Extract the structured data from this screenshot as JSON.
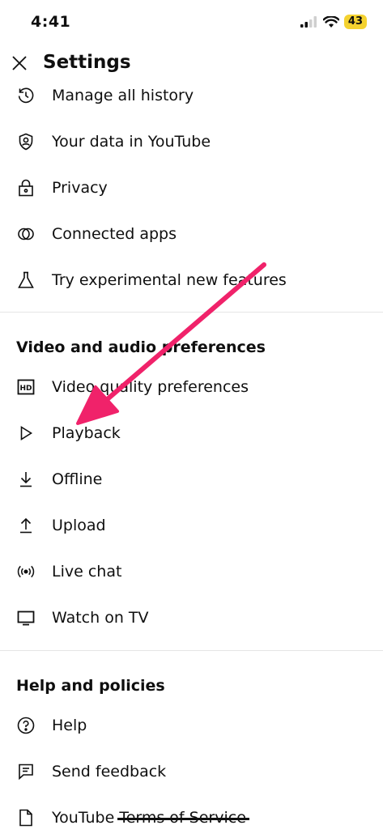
{
  "status_bar": {
    "time": "4:41",
    "battery": "43"
  },
  "header": {
    "title": "Settings"
  },
  "general_items": [
    {
      "label": "Manage all history",
      "icon": "history-icon"
    },
    {
      "label": "Your data in YouTube",
      "icon": "shield-person-icon"
    },
    {
      "label": "Privacy",
      "icon": "lock-icon"
    },
    {
      "label": "Connected apps",
      "icon": "connected-apps-icon"
    },
    {
      "label": "Try experimental new features",
      "icon": "flask-icon"
    }
  ],
  "video_audio": {
    "title": "Video and audio preferences",
    "items": [
      {
        "label": "Video quality preferences",
        "icon": "hd-icon"
      },
      {
        "label": "Playback",
        "icon": "play-icon"
      },
      {
        "label": "Offline",
        "icon": "download-icon"
      },
      {
        "label": "Upload",
        "icon": "upload-icon"
      },
      {
        "label": "Live chat",
        "icon": "live-icon"
      },
      {
        "label": "Watch on TV",
        "icon": "tv-icon"
      }
    ]
  },
  "help": {
    "title": "Help and policies",
    "items": [
      {
        "label": "Help",
        "icon": "help-icon"
      },
      {
        "label": "Send feedback",
        "icon": "feedback-icon"
      },
      {
        "label_main": "YouTube",
        "label_struck": "Terms of Service",
        "icon": "document-icon"
      }
    ]
  },
  "colors": {
    "arrow": "#f0226a",
    "battery": "#f4d230",
    "text": "#0f0f0f"
  }
}
